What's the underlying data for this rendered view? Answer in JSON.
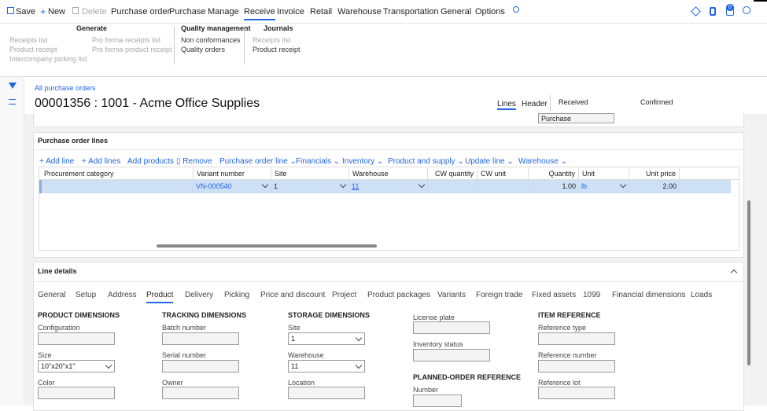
{
  "toolbar": {
    "save": "Save",
    "new": "New",
    "delete": "Delete",
    "menus": [
      "Purchase order",
      "Purchase",
      "Manage",
      "Receive",
      "Invoice",
      "Retail",
      "Warehouse",
      "Transportation",
      "General",
      "Options"
    ],
    "badge": "0"
  },
  "ribbon": {
    "generate": {
      "heading": "Generate",
      "col1": [
        "Receipts list",
        "Product receipt",
        "Intercompany picking list"
      ],
      "col2": [
        "Pro forma receipts list",
        "Pro forma product receipt"
      ]
    },
    "quality": {
      "heading": "Quality management",
      "items": [
        "Non conformances",
        "Quality orders"
      ]
    },
    "journals": {
      "heading": "Journals",
      "items": [
        "Receipts list",
        "Product receipt"
      ]
    }
  },
  "page": {
    "breadcrumb": "All purchase orders",
    "title": "00001356 : 1001 - Acme Office Supplies",
    "view_lines": "Lines",
    "view_header": "Header",
    "status1": "Received",
    "status2": "Confirmed",
    "purchase_type": "Purchase"
  },
  "lines": {
    "section_title": "Purchase order lines",
    "toolbar": [
      "Add line",
      "Add lines",
      "Add products",
      "Remove",
      "Purchase order line",
      "Financials",
      "Inventory",
      "Product and supply",
      "Update line",
      "Warehouse"
    ],
    "columns": [
      "Procurement category",
      "Variant number",
      "Site",
      "Warehouse",
      "CW quantity",
      "CW unit",
      "Quantity",
      "Unit",
      "Unit price"
    ],
    "row": {
      "procurement_category": "",
      "variant_number": "VN-000540",
      "site": "1",
      "warehouse": "11",
      "cw_quantity": "",
      "cw_unit": "",
      "quantity": "1.00",
      "unit": "lb",
      "unit_price": "2.00"
    }
  },
  "line_details": {
    "title": "Line details",
    "tabs": [
      "General",
      "Setup",
      "Address",
      "Product",
      "Delivery",
      "Picking",
      "Price and discount",
      "Project",
      "Product packages",
      "Variants",
      "Foreign trade",
      "Fixed assets",
      "1099",
      "Financial dimensions",
      "Loads"
    ],
    "product_dimensions": {
      "heading": "PRODUCT DIMENSIONS",
      "configuration_label": "Configuration",
      "configuration": "",
      "size_label": "Size",
      "size": "10\"x20\"x1\"",
      "color_label": "Color",
      "color": ""
    },
    "tracking_dimensions": {
      "heading": "TRACKING DIMENSIONS",
      "batch_label": "Batch number",
      "serial_label": "Serial number",
      "owner_label": "Owner"
    },
    "storage_dimensions": {
      "heading": "STORAGE DIMENSIONS",
      "site_label": "Site",
      "site": "1",
      "warehouse_label": "Warehouse",
      "warehouse": "11",
      "location_label": "Location"
    },
    "other": {
      "license_plate_label": "License plate",
      "inventory_status_label": "Inventory status",
      "planned_heading": "PLANNED-ORDER REFERENCE",
      "number_label": "Number"
    },
    "item_reference": {
      "heading": "ITEM REFERENCE",
      "reference_type_label": "Reference type",
      "reference_number_label": "Reference number",
      "reference_lot_label": "Reference lot"
    }
  }
}
